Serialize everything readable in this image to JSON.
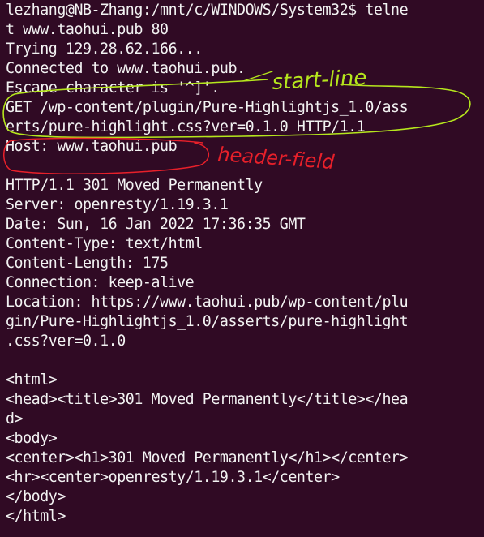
{
  "terminal": {
    "lines": [
      "lezhang@NB-Zhang:/mnt/c/WINDOWS/System32$ telne",
      "t www.taohui.pub 80",
      "Trying 129.28.62.166...",
      "Connected to www.taohui.pub.",
      "Escape character is '^]'.",
      "GET /wp-content/plugin/Pure-Highlightjs_1.0/ass",
      "erts/pure-highlight.css?ver=0.1.0 HTTP/1.1",
      "Host: www.taohui.pub",
      "",
      "HTTP/1.1 301 Moved Permanently",
      "Server: openresty/1.19.3.1",
      "Date: Sun, 16 Jan 2022 17:36:35 GMT",
      "Content-Type: text/html",
      "Content-Length: 175",
      "Connection: keep-alive",
      "Location: https://www.taohui.pub/wp-content/plu",
      "gin/Pure-Highlightjs_1.0/asserts/pure-highlight",
      ".css?ver=0.1.0",
      "",
      "<html>",
      "<head><title>301 Moved Permanently</title></hea",
      "d>",
      "<body>",
      "<center><h1>301 Moved Permanently</h1></center>",
      "<hr><center>openresty/1.19.3.1</center>",
      "</body>",
      "</html>"
    ]
  },
  "annotations": {
    "start_line_label": "start-line",
    "start_line_color": "#b5e61d",
    "header_field_label": "header-field",
    "header_field_color": "#e8202a"
  },
  "colors": {
    "background": "#300a24",
    "foreground": "#f2f2f2"
  }
}
